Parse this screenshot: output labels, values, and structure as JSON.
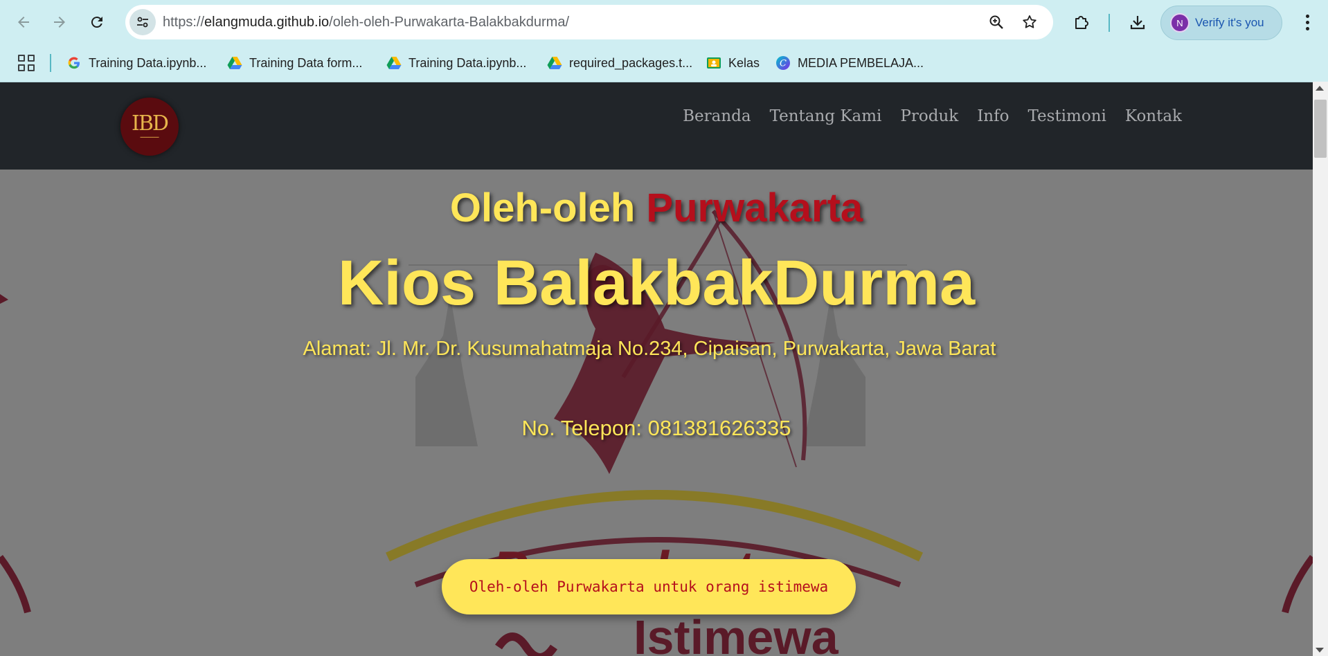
{
  "browser": {
    "url_scheme": "https://",
    "url_host": "elangmuda.github.io",
    "url_path": "/oleh-oleh-Purwakarta-Balakbakdurma/",
    "verify_label": "Verify it's you",
    "avatar_initial": "N"
  },
  "bookmarks": [
    {
      "label": "Training Data.ipynb...",
      "icon": "google-icon"
    },
    {
      "label": "Training Data form...",
      "icon": "drive-icon"
    },
    {
      "label": "Training Data.ipynb...",
      "icon": "drive-icon"
    },
    {
      "label": "required_packages.t...",
      "icon": "drive-icon"
    },
    {
      "label": "Kelas",
      "icon": "classroom-icon"
    },
    {
      "label": "MEDIA PEMBELAJA...",
      "icon": "canva-icon"
    }
  ],
  "site": {
    "logo_text": "IBD",
    "nav": [
      "Beranda",
      "Tentang Kami",
      "Produk",
      "Info",
      "Testimoni",
      "Kontak"
    ]
  },
  "hero": {
    "title_part1": "Oleh-oleh ",
    "title_part2": "Purwakarta",
    "headline": "Kios BalakbakDurma",
    "address": "Alamat: Jl. Mr. Dr. Kusumahatmaja No.234, Cipaisan, Purwakarta, Jawa Barat",
    "phone": "No. Telepon: 081381626335",
    "cta_label": "Oleh-oleh Purwakarta untuk orang istimewa",
    "bg_word1": "Purwakarta",
    "bg_word2": "Istimewa"
  },
  "colors": {
    "accent_yellow": "#ffe659",
    "accent_red": "#b50f1c",
    "navbar": "#212529"
  }
}
